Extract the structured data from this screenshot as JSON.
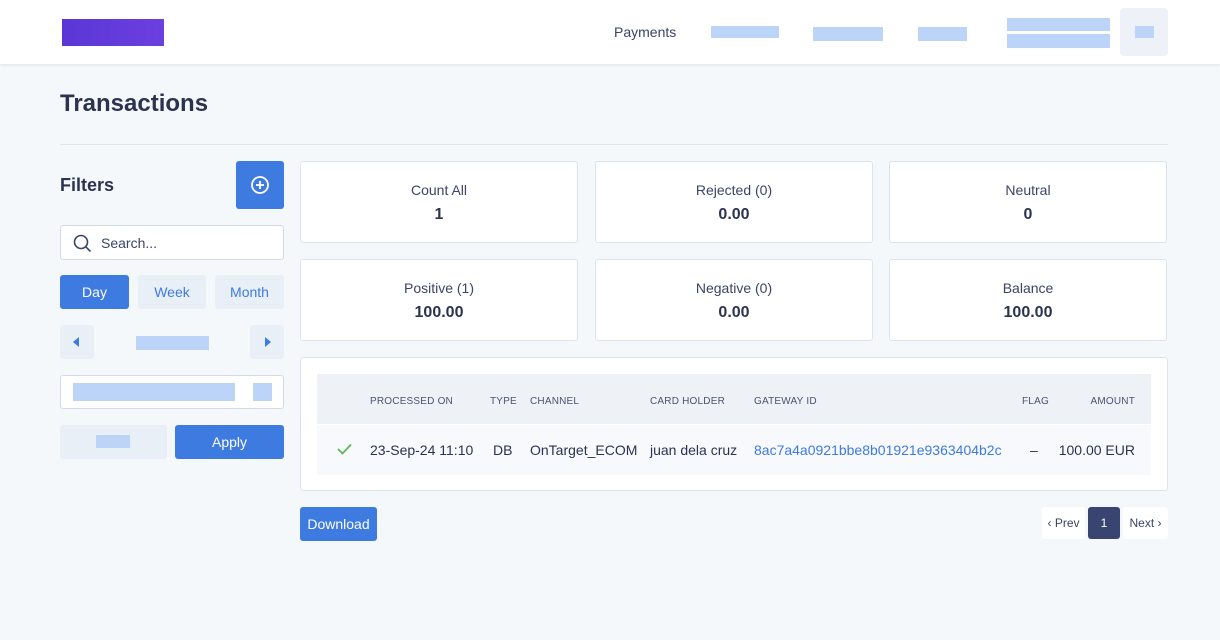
{
  "nav": {
    "payments_label": "Payments"
  },
  "page": {
    "title": "Transactions"
  },
  "filters": {
    "title": "Filters",
    "search_placeholder": "Search...",
    "periods": [
      "Day",
      "Week",
      "Month"
    ],
    "selected_period": "Day",
    "apply_label": "Apply"
  },
  "stats": [
    {
      "label": "Count All",
      "value": "1"
    },
    {
      "label": "Rejected (0)",
      "value": "0.00"
    },
    {
      "label": "Neutral",
      "value": "0"
    },
    {
      "label": "Positive (1)",
      "value": "100.00"
    },
    {
      "label": "Negative (0)",
      "value": "0.00"
    },
    {
      "label": "Balance",
      "value": "100.00"
    }
  ],
  "table": {
    "columns": [
      "PROCESSED ON",
      "TYPE",
      "CHANNEL",
      "CARD HOLDER",
      "GATEWAY ID",
      "FLAG",
      "AMOUNT"
    ],
    "rows": [
      {
        "processed_on": "23-Sep-24 11:10",
        "type": "DB",
        "channel": "OnTarget_ECOM",
        "card_holder": "juan dela cruz",
        "gateway_id": "8ac7a4a0921bbe8b01921e9363404b2c",
        "flag": "–",
        "amount": "100.00 EUR",
        "status_icon": "check-icon"
      }
    ]
  },
  "actions": {
    "download_label": "Download"
  },
  "pagination": {
    "prev_label": "‹ Prev",
    "current_page": "1",
    "next_label": "Next ›"
  },
  "colors": {
    "accent": "#3d7be0",
    "brand": "#5b36d6",
    "success": "#5cb85c",
    "dark": "#3a4470"
  }
}
